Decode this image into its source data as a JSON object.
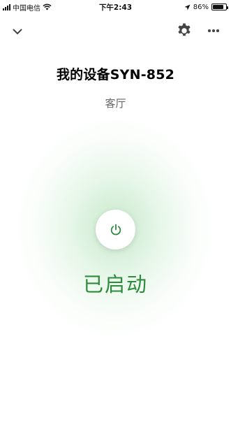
{
  "status_bar": {
    "carrier": "中国电信",
    "time": "下午2:43",
    "battery_percent": "86%",
    "battery_level": 0.86,
    "icons": [
      "signal-icon",
      "wifi-icon",
      "location-arrow-icon",
      "battery-icon"
    ]
  },
  "nav": {
    "back_icon": "chevron-down-icon",
    "settings_icon": "gear-icon",
    "more_icon": "more-dots-icon"
  },
  "device": {
    "title": "我的设备SYN-852",
    "room": "客厅"
  },
  "power": {
    "icon": "power-icon",
    "state_text": "已启动",
    "accent_color": "#2e8b3c",
    "glow_color": "#cdeccf"
  }
}
